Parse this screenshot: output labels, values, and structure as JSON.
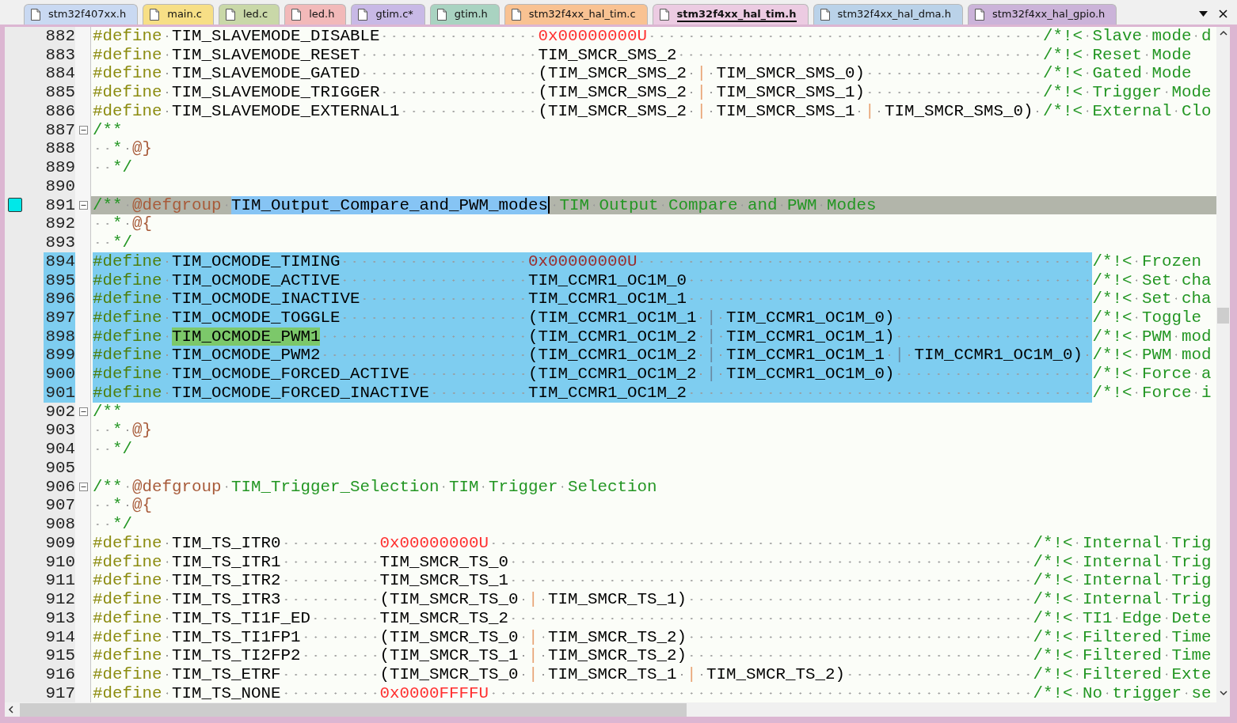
{
  "tabs": [
    {
      "label": "stm32f407xx.h",
      "selected": false,
      "color": "#c9d9f2"
    },
    {
      "label": "main.c",
      "selected": false,
      "color": "#f7df86"
    },
    {
      "label": "led.c",
      "selected": false,
      "color": "#c9d8a8"
    },
    {
      "label": "led.h",
      "selected": false,
      "color": "#f2b9b9"
    },
    {
      "label": "gtim.c*",
      "selected": false,
      "color": "#c8b9e6"
    },
    {
      "label": "gtim.h",
      "selected": false,
      "color": "#a9d3c1"
    },
    {
      "label": "stm32f4xx_hal_tim.c",
      "selected": false,
      "color": "#f9c292"
    },
    {
      "label": "stm32f4xx_hal_tim.h",
      "selected": true,
      "color": "#eccbe2"
    },
    {
      "label": "stm32f4xx_hal_dma.h",
      "selected": false,
      "color": "#bad2e9"
    },
    {
      "label": "stm32f4xx_hal_gpio.h",
      "selected": false,
      "color": "#cbb3d9"
    }
  ],
  "lines": [
    {
      "number": "882",
      "selected": false,
      "current": false,
      "bookmark": false,
      "fold": false,
      "segments": [
        {
          "kind": "directive",
          "text": "#define "
        },
        {
          "kind": "name",
          "text": "TIM_SLAVEMODE_DISABLE                "
        },
        {
          "kind": "number",
          "text": "0x00000000U                                        "
        },
        {
          "kind": "comment",
          "text": "/*!< Slave mode d"
        }
      ]
    },
    {
      "number": "883",
      "selected": false,
      "current": false,
      "bookmark": false,
      "fold": false,
      "segments": [
        {
          "kind": "directive",
          "text": "#define "
        },
        {
          "kind": "name",
          "text": "TIM_SLAVEMODE_RESET                  "
        },
        {
          "kind": "value",
          "text": "TIM_SMCR_SMS_2                                     "
        },
        {
          "kind": "comment",
          "text": "/*!< Reset Mode"
        }
      ]
    },
    {
      "number": "884",
      "selected": false,
      "current": false,
      "bookmark": false,
      "fold": false,
      "segments": [
        {
          "kind": "directive",
          "text": "#define "
        },
        {
          "kind": "name",
          "text": "TIM_SLAVEMODE_GATED                  "
        },
        {
          "kind": "value",
          "text": "(TIM_SMCR_SMS_2 "
        },
        {
          "kind": "operator",
          "text": "|"
        },
        {
          "kind": "value",
          "text": " TIM_SMCR_SMS_0)                  "
        },
        {
          "kind": "comment",
          "text": "/*!< Gated Mode"
        }
      ]
    },
    {
      "number": "885",
      "selected": false,
      "current": false,
      "bookmark": false,
      "fold": false,
      "segments": [
        {
          "kind": "directive",
          "text": "#define "
        },
        {
          "kind": "name",
          "text": "TIM_SLAVEMODE_TRIGGER                "
        },
        {
          "kind": "value",
          "text": "(TIM_SMCR_SMS_2 "
        },
        {
          "kind": "operator",
          "text": "|"
        },
        {
          "kind": "value",
          "text": " TIM_SMCR_SMS_1)                  "
        },
        {
          "kind": "comment",
          "text": "/*!< Trigger Mode"
        }
      ]
    },
    {
      "number": "886",
      "selected": false,
      "current": false,
      "bookmark": false,
      "fold": false,
      "segments": [
        {
          "kind": "directive",
          "text": "#define "
        },
        {
          "kind": "name",
          "text": "TIM_SLAVEMODE_EXTERNAL1              "
        },
        {
          "kind": "value",
          "text": "(TIM_SMCR_SMS_2 "
        },
        {
          "kind": "operator",
          "text": "|"
        },
        {
          "kind": "value",
          "text": " TIM_SMCR_SMS_1 "
        },
        {
          "kind": "operator",
          "text": "|"
        },
        {
          "kind": "value",
          "text": " TIM_SMCR_SMS_0) "
        },
        {
          "kind": "comment",
          "text": "/*!< External Clo"
        }
      ]
    },
    {
      "number": "887",
      "selected": false,
      "current": false,
      "bookmark": false,
      "fold": true,
      "segments": [
        {
          "kind": "comment",
          "text": "/**"
        }
      ]
    },
    {
      "number": "888",
      "selected": false,
      "current": false,
      "bookmark": false,
      "fold": false,
      "segments": [
        {
          "kind": "comment",
          "text": "  * "
        },
        {
          "kind": "doctag",
          "text": "@}"
        }
      ]
    },
    {
      "number": "889",
      "selected": false,
      "current": false,
      "bookmark": false,
      "fold": false,
      "segments": [
        {
          "kind": "comment",
          "text": "  */"
        }
      ]
    },
    {
      "number": "890",
      "selected": false,
      "current": false,
      "bookmark": false,
      "fold": false
    },
    {
      "number": "891",
      "selected": false,
      "current": true,
      "bookmark": true,
      "fold": true,
      "segments": [
        {
          "kind": "comment",
          "text": "/** "
        },
        {
          "kind": "doctag",
          "text": "@defgroup "
        },
        {
          "kind": "selection",
          "text": "TIM_Output_Compare_and_PWM_modes"
        },
        {
          "kind": "comment",
          "text": " TIM Output Compare and PWM Modes"
        }
      ]
    },
    {
      "number": "892",
      "selected": false,
      "current": false,
      "bookmark": false,
      "fold": false,
      "segments": [
        {
          "kind": "comment",
          "text": "  * "
        },
        {
          "kind": "doctag",
          "text": "@{"
        }
      ]
    },
    {
      "number": "893",
      "selected": false,
      "current": false,
      "bookmark": false,
      "fold": false,
      "segments": [
        {
          "kind": "comment",
          "text": "  */"
        }
      ]
    },
    {
      "number": "894",
      "selected": true,
      "current": false,
      "bookmark": false,
      "fold": false,
      "segments": [
        {
          "kind": "directive",
          "text": "#define "
        },
        {
          "kind": "name",
          "text": "TIM_OCMODE_TIMING                   "
        },
        {
          "kind": "number",
          "text": "0x00000000U                                              "
        },
        {
          "kind": "comment",
          "text": "/*!< Frozen"
        }
      ]
    },
    {
      "number": "895",
      "selected": true,
      "current": false,
      "bookmark": false,
      "fold": false,
      "segments": [
        {
          "kind": "directive",
          "text": "#define "
        },
        {
          "kind": "name",
          "text": "TIM_OCMODE_ACTIVE                   "
        },
        {
          "kind": "value",
          "text": "TIM_CCMR1_OC1M_0                                         "
        },
        {
          "kind": "comment",
          "text": "/*!< Set cha"
        }
      ]
    },
    {
      "number": "896",
      "selected": true,
      "current": false,
      "bookmark": false,
      "fold": false,
      "segments": [
        {
          "kind": "directive",
          "text": "#define "
        },
        {
          "kind": "name",
          "text": "TIM_OCMODE_INACTIVE                 "
        },
        {
          "kind": "value",
          "text": "TIM_CCMR1_OC1M_1                                         "
        },
        {
          "kind": "comment",
          "text": "/*!< Set cha"
        }
      ]
    },
    {
      "number": "897",
      "selected": true,
      "current": false,
      "bookmark": false,
      "fold": false,
      "segments": [
        {
          "kind": "directive",
          "text": "#define "
        },
        {
          "kind": "name",
          "text": "TIM_OCMODE_TOGGLE                   "
        },
        {
          "kind": "value",
          "text": "(TIM_CCMR1_OC1M_1 "
        },
        {
          "kind": "operator",
          "text": "|"
        },
        {
          "kind": "value",
          "text": " TIM_CCMR1_OC1M_0)                    "
        },
        {
          "kind": "comment",
          "text": "/*!< Toggle"
        }
      ]
    },
    {
      "number": "898",
      "selected": true,
      "current": false,
      "bookmark": false,
      "fold": false,
      "segments": [
        {
          "kind": "directive",
          "text": "#define "
        },
        {
          "kind": "match",
          "text": "TIM_OCMODE_PWM1                     "
        },
        {
          "kind": "value",
          "text": "(TIM_CCMR1_OC1M_2 "
        },
        {
          "kind": "operator",
          "text": "|"
        },
        {
          "kind": "value",
          "text": " TIM_CCMR1_OC1M_1)                    "
        },
        {
          "kind": "comment",
          "text": "/*!< PWM mod"
        }
      ]
    },
    {
      "number": "899",
      "selected": true,
      "current": false,
      "bookmark": false,
      "fold": false,
      "segments": [
        {
          "kind": "directive",
          "text": "#define "
        },
        {
          "kind": "name",
          "text": "TIM_OCMODE_PWM2                     "
        },
        {
          "kind": "value",
          "text": "(TIM_CCMR1_OC1M_2 "
        },
        {
          "kind": "operator",
          "text": "|"
        },
        {
          "kind": "value",
          "text": " TIM_CCMR1_OC1M_1 "
        },
        {
          "kind": "operator",
          "text": "|"
        },
        {
          "kind": "value",
          "text": " TIM_CCMR1_OC1M_0) "
        },
        {
          "kind": "comment",
          "text": "/*!< PWM mod"
        }
      ]
    },
    {
      "number": "900",
      "selected": true,
      "current": false,
      "bookmark": false,
      "fold": false,
      "segments": [
        {
          "kind": "directive",
          "text": "#define "
        },
        {
          "kind": "name",
          "text": "TIM_OCMODE_FORCED_ACTIVE            "
        },
        {
          "kind": "value",
          "text": "(TIM_CCMR1_OC1M_2 "
        },
        {
          "kind": "operator",
          "text": "|"
        },
        {
          "kind": "value",
          "text": " TIM_CCMR1_OC1M_0)                    "
        },
        {
          "kind": "comment",
          "text": "/*!< Force a"
        }
      ]
    },
    {
      "number": "901",
      "selected": true,
      "current": false,
      "bookmark": false,
      "fold": false,
      "segments": [
        {
          "kind": "directive",
          "text": "#define "
        },
        {
          "kind": "name",
          "text": "TIM_OCMODE_FORCED_INACTIVE          "
        },
        {
          "kind": "value",
          "text": "TIM_CCMR1_OC1M_2                                         "
        },
        {
          "kind": "comment",
          "text": "/*!< Force i"
        }
      ]
    },
    {
      "number": "902",
      "selected": false,
      "current": false,
      "bookmark": false,
      "fold": true,
      "segments": [
        {
          "kind": "comment",
          "text": "/**"
        }
      ]
    },
    {
      "number": "903",
      "selected": false,
      "current": false,
      "bookmark": false,
      "fold": false,
      "segments": [
        {
          "kind": "comment",
          "text": "  * "
        },
        {
          "kind": "doctag",
          "text": "@}"
        }
      ]
    },
    {
      "number": "904",
      "selected": false,
      "current": false,
      "bookmark": false,
      "fold": false,
      "segments": [
        {
          "kind": "comment",
          "text": "  */"
        }
      ]
    },
    {
      "number": "905",
      "selected": false,
      "current": false,
      "bookmark": false,
      "fold": false
    },
    {
      "number": "906",
      "selected": false,
      "current": false,
      "bookmark": false,
      "fold": true,
      "segments": [
        {
          "kind": "comment",
          "text": "/** "
        },
        {
          "kind": "doctag",
          "text": "@defgroup "
        },
        {
          "kind": "comment",
          "text": "TIM_Trigger_Selection TIM Trigger Selection"
        }
      ]
    },
    {
      "number": "907",
      "selected": false,
      "current": false,
      "bookmark": false,
      "fold": false,
      "segments": [
        {
          "kind": "comment",
          "text": "  * "
        },
        {
          "kind": "doctag",
          "text": "@{"
        }
      ]
    },
    {
      "number": "908",
      "selected": false,
      "current": false,
      "bookmark": false,
      "fold": false,
      "segments": [
        {
          "kind": "comment",
          "text": "  */"
        }
      ]
    },
    {
      "number": "909",
      "selected": false,
      "current": false,
      "bookmark": false,
      "fold": false,
      "segments": [
        {
          "kind": "directive",
          "text": "#define "
        },
        {
          "kind": "name",
          "text": "TIM_TS_ITR0          "
        },
        {
          "kind": "number",
          "text": "0x00000000U                                                       "
        },
        {
          "kind": "comment",
          "text": "/*!< Internal Trig"
        }
      ]
    },
    {
      "number": "910",
      "selected": false,
      "current": false,
      "bookmark": false,
      "fold": false,
      "segments": [
        {
          "kind": "directive",
          "text": "#define "
        },
        {
          "kind": "name",
          "text": "TIM_TS_ITR1          "
        },
        {
          "kind": "value",
          "text": "TIM_SMCR_TS_0                                                     "
        },
        {
          "kind": "comment",
          "text": "/*!< Internal Trig"
        }
      ]
    },
    {
      "number": "911",
      "selected": false,
      "current": false,
      "bookmark": false,
      "fold": false,
      "segments": [
        {
          "kind": "directive",
          "text": "#define "
        },
        {
          "kind": "name",
          "text": "TIM_TS_ITR2          "
        },
        {
          "kind": "value",
          "text": "TIM_SMCR_TS_1                                                     "
        },
        {
          "kind": "comment",
          "text": "/*!< Internal Trig"
        }
      ]
    },
    {
      "number": "912",
      "selected": false,
      "current": false,
      "bookmark": false,
      "fold": false,
      "segments": [
        {
          "kind": "directive",
          "text": "#define "
        },
        {
          "kind": "name",
          "text": "TIM_TS_ITR3          "
        },
        {
          "kind": "value",
          "text": "(TIM_SMCR_TS_0 "
        },
        {
          "kind": "operator",
          "text": "|"
        },
        {
          "kind": "value",
          "text": " TIM_SMCR_TS_1)                                   "
        },
        {
          "kind": "comment",
          "text": "/*!< Internal Trig"
        }
      ]
    },
    {
      "number": "913",
      "selected": false,
      "current": false,
      "bookmark": false,
      "fold": false,
      "segments": [
        {
          "kind": "directive",
          "text": "#define "
        },
        {
          "kind": "name",
          "text": "TIM_TS_TI1F_ED       "
        },
        {
          "kind": "value",
          "text": "TIM_SMCR_TS_2                                                     "
        },
        {
          "kind": "comment",
          "text": "/*!< TI1 Edge Dete"
        }
      ]
    },
    {
      "number": "914",
      "selected": false,
      "current": false,
      "bookmark": false,
      "fold": false,
      "segments": [
        {
          "kind": "directive",
          "text": "#define "
        },
        {
          "kind": "name",
          "text": "TIM_TS_TI1FP1        "
        },
        {
          "kind": "value",
          "text": "(TIM_SMCR_TS_0 "
        },
        {
          "kind": "operator",
          "text": "|"
        },
        {
          "kind": "value",
          "text": " TIM_SMCR_TS_2)                                   "
        },
        {
          "kind": "comment",
          "text": "/*!< Filtered Time"
        }
      ]
    },
    {
      "number": "915",
      "selected": false,
      "current": false,
      "bookmark": false,
      "fold": false,
      "segments": [
        {
          "kind": "directive",
          "text": "#define "
        },
        {
          "kind": "name",
          "text": "TIM_TS_TI2FP2        "
        },
        {
          "kind": "value",
          "text": "(TIM_SMCR_TS_1 "
        },
        {
          "kind": "operator",
          "text": "|"
        },
        {
          "kind": "value",
          "text": " TIM_SMCR_TS_2)                                   "
        },
        {
          "kind": "comment",
          "text": "/*!< Filtered Time"
        }
      ]
    },
    {
      "number": "916",
      "selected": false,
      "current": false,
      "bookmark": false,
      "fold": false,
      "segments": [
        {
          "kind": "directive",
          "text": "#define "
        },
        {
          "kind": "name",
          "text": "TIM_TS_ETRF          "
        },
        {
          "kind": "value",
          "text": "(TIM_SMCR_TS_0 "
        },
        {
          "kind": "operator",
          "text": "|"
        },
        {
          "kind": "value",
          "text": " TIM_SMCR_TS_1 "
        },
        {
          "kind": "operator",
          "text": "|"
        },
        {
          "kind": "value",
          "text": " TIM_SMCR_TS_2)                   "
        },
        {
          "kind": "comment",
          "text": "/*!< Filtered Exte"
        }
      ]
    },
    {
      "number": "917",
      "selected": false,
      "current": false,
      "bookmark": false,
      "fold": false,
      "segments": [
        {
          "kind": "directive",
          "text": "#define "
        },
        {
          "kind": "name",
          "text": "TIM_TS_NONE          "
        },
        {
          "kind": "number",
          "text": "0x0000FFFFU                                                       "
        },
        {
          "kind": "comment",
          "text": "/*!< No trigger se"
        }
      ]
    }
  ]
}
